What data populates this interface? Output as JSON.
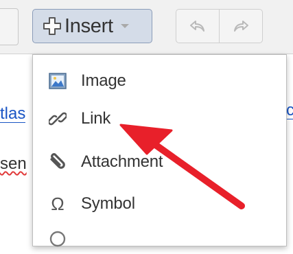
{
  "toolbar": {
    "insert_label": "Insert"
  },
  "editor": {
    "fragment_link": "tlas",
    "fragment_text": "sen",
    "fragment_right": "c"
  },
  "menu": {
    "items": [
      {
        "label": "Image",
        "icon": "image-icon"
      },
      {
        "label": "Link",
        "icon": "link-icon"
      },
      {
        "label": "Attachment",
        "icon": "paperclip-icon"
      },
      {
        "label": "Symbol",
        "icon": "omega-icon"
      }
    ]
  },
  "annotation": {
    "arrow_color": "#e8202a"
  },
  "colors": {
    "link": "#1a55c4",
    "insert_button_bg": "#d4dce8",
    "arrow": "#e8202a"
  }
}
